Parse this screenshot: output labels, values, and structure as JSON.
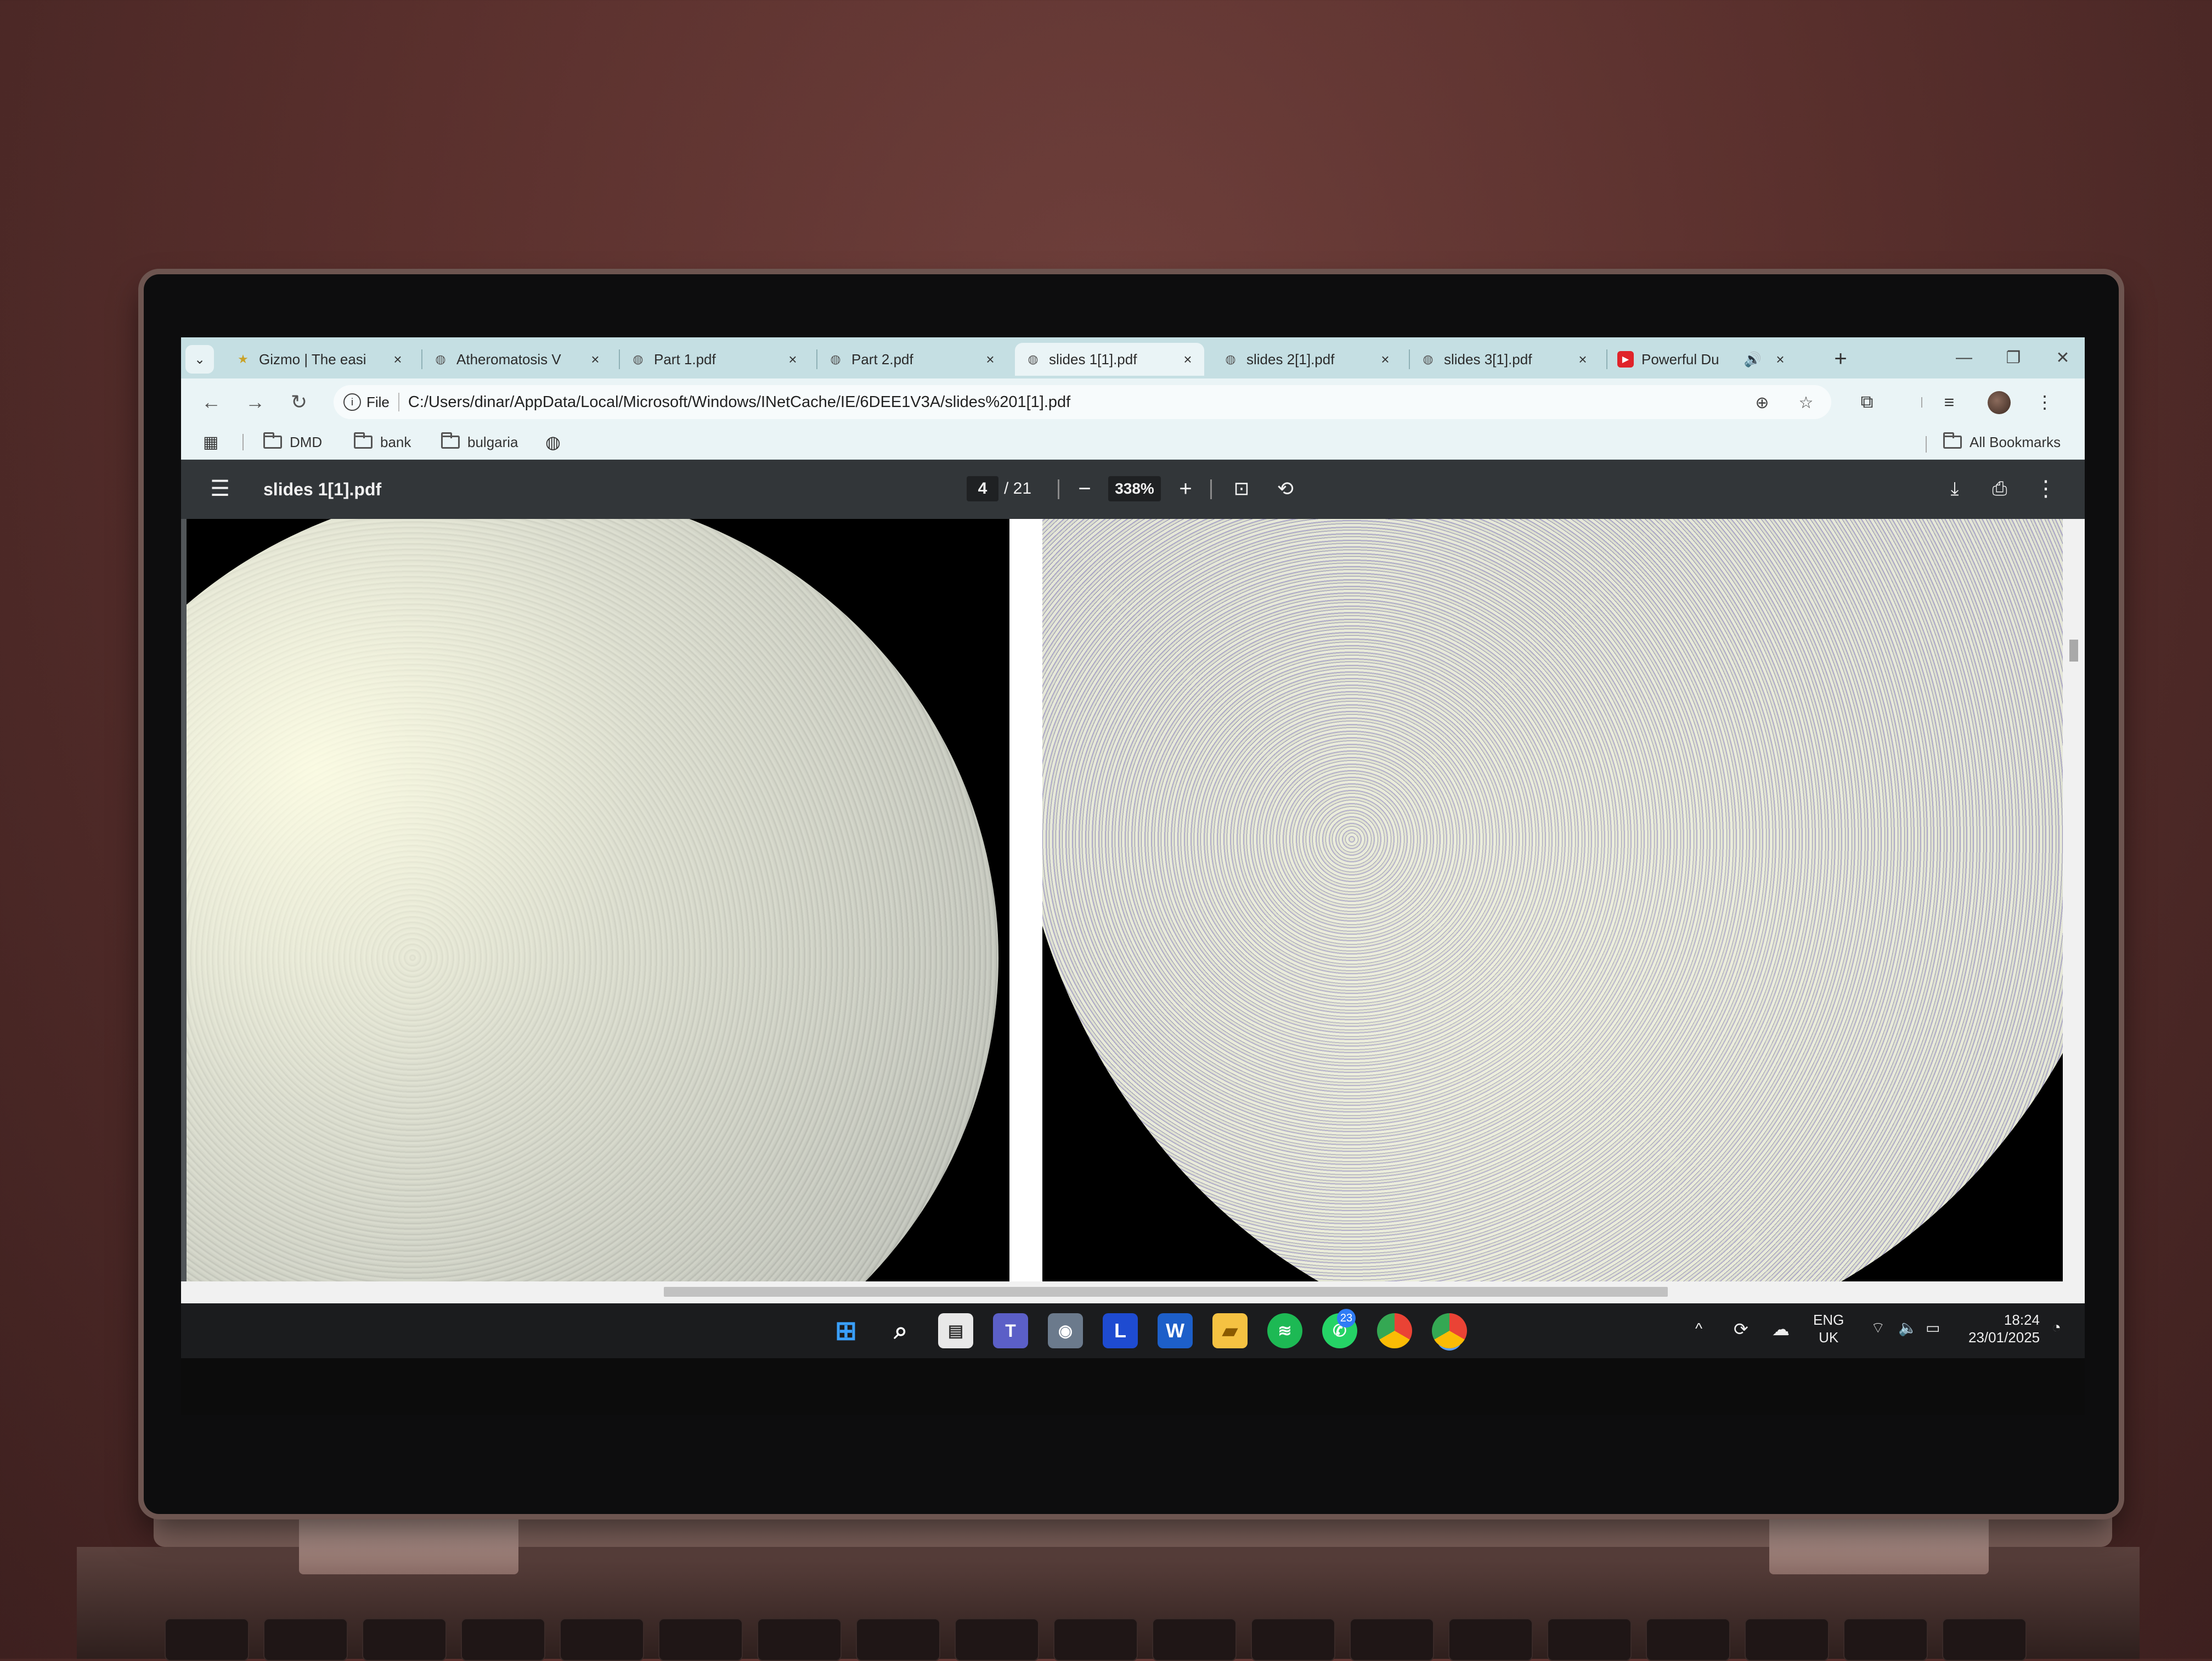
{
  "browser": {
    "tabs": [
      {
        "title": "Gizmo | The easi",
        "favicon": "star-icon",
        "active": false
      },
      {
        "title": "Atheromatosis V",
        "favicon": "globe-icon",
        "active": false
      },
      {
        "title": "Part 1.pdf",
        "favicon": "globe-icon",
        "active": false
      },
      {
        "title": "Part 2.pdf",
        "favicon": "globe-icon",
        "active": false
      },
      {
        "title": "slides 1[1].pdf",
        "favicon": "globe-icon",
        "active": true
      },
      {
        "title": "slides 2[1].pdf",
        "favicon": "globe-icon",
        "active": false
      },
      {
        "title": "slides 3[1].pdf",
        "favicon": "globe-icon",
        "active": false
      },
      {
        "title": "Powerful Du",
        "favicon": "youtube-icon",
        "active": false
      }
    ],
    "close_glyph": "×",
    "new_tab_glyph": "+",
    "site_chip_label": "File",
    "url": "C:/Users/dinar/AppData/Local/Microsoft/Windows/INetCache/IE/6DEE1V3A/slides%201[1].pdf",
    "bookmarks": [
      "DMD",
      "bank",
      "bulgaria"
    ],
    "all_bookmarks_label": "All Bookmarks",
    "accent_color": "#c5dfe3"
  },
  "pdf_viewer": {
    "title": "slides 1[1].pdf",
    "current_page": "4",
    "total_pages": "/ 21",
    "zoom": "338%"
  },
  "taskbar": {
    "apps": [
      "start-icon",
      "search-icon",
      "store-icon",
      "teams-icon",
      "camera-icon",
      "L",
      "W",
      "file-explorer-icon",
      "spotify-icon",
      "whatsapp-icon",
      "chrome-icon",
      "chrome-icon"
    ],
    "whatsapp_badge": "23",
    "lang_top": "ENG",
    "lang_bottom": "UK",
    "time": "18:24",
    "date": "23/01/2025"
  }
}
